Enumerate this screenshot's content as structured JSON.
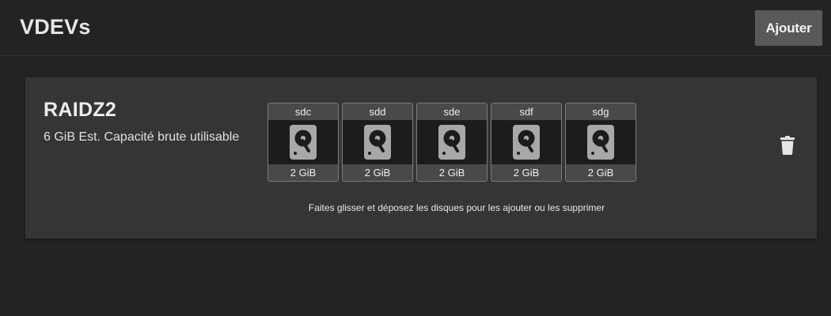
{
  "header": {
    "title": "VDEVs",
    "add_label": "Ajouter"
  },
  "vdev": {
    "type": "RAIDZ2",
    "capacity_text": "6 GiB Est. Capacité brute utilisable",
    "hint": "Faites glisser et déposez les disques pour les ajouter ou les supprimer",
    "disks": [
      {
        "name": "sdc",
        "size": "2 GiB"
      },
      {
        "name": "sdd",
        "size": "2 GiB"
      },
      {
        "name": "sde",
        "size": "2 GiB"
      },
      {
        "name": "sdf",
        "size": "2 GiB"
      },
      {
        "name": "sdg",
        "size": "2 GiB"
      }
    ],
    "disk_icon": "harddisk-icon",
    "delete_icon": "trash-icon"
  },
  "colors": {
    "background": "#232323",
    "card": "#353535",
    "button": "#595959",
    "disk_label_bg": "#494949"
  }
}
